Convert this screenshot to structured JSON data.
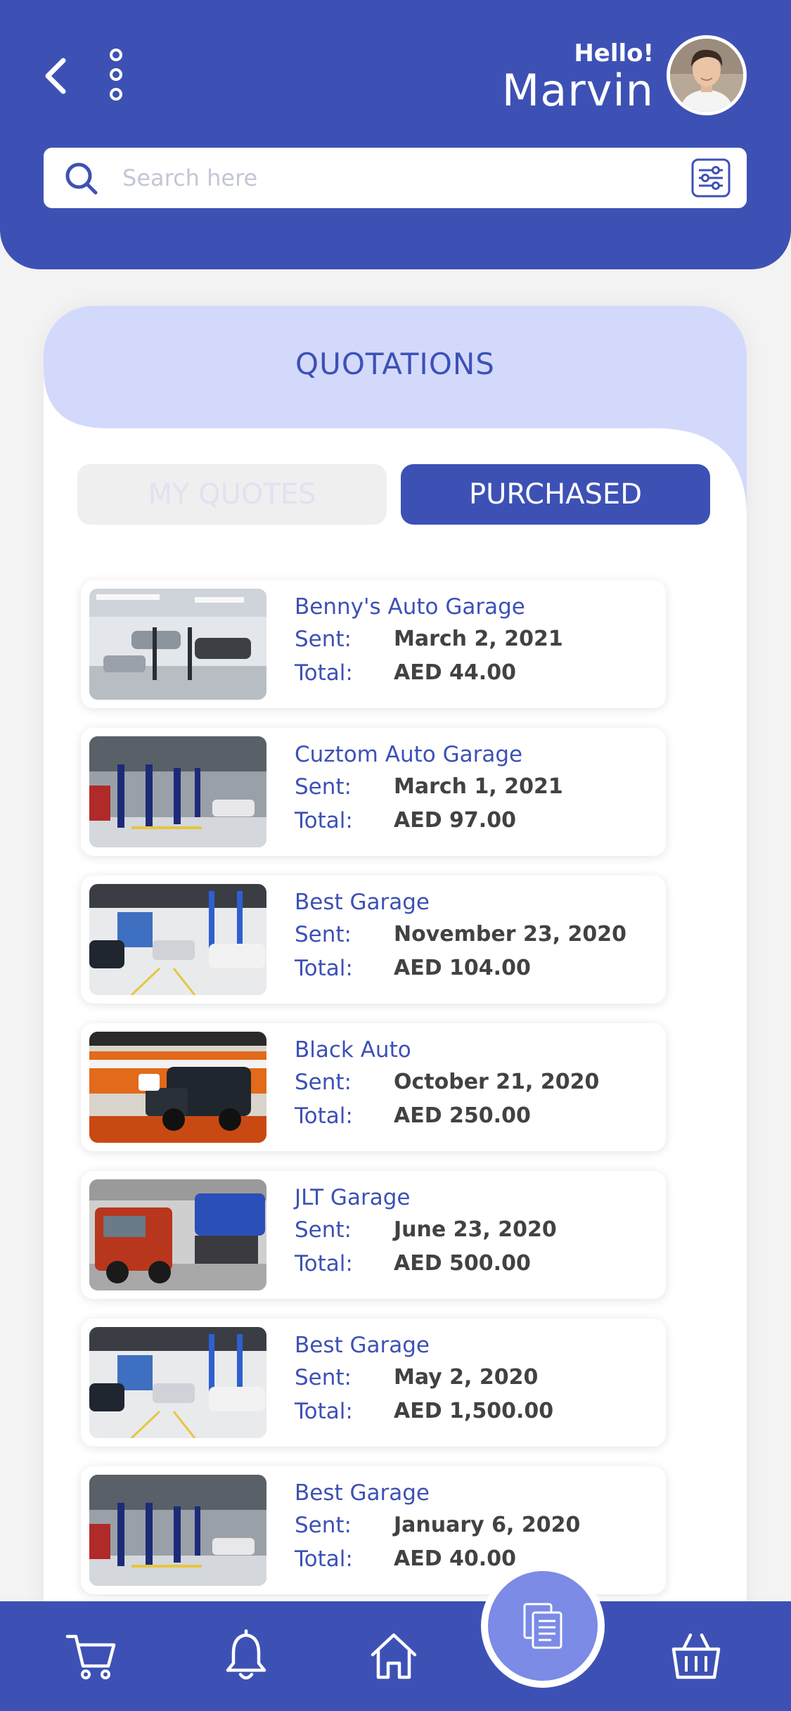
{
  "header": {
    "greeting": "Hello!",
    "user_name": "Marvin",
    "search_placeholder": "Search here"
  },
  "section": {
    "title": "QUOTATIONS",
    "tabs": [
      {
        "label": "MY QUOTES",
        "active": false
      },
      {
        "label": "PURCHASED",
        "active": true
      }
    ]
  },
  "labels": {
    "sent": "Sent:",
    "total": "Total:"
  },
  "quotes": [
    {
      "garage": "Benny's Auto Garage",
      "sent": "March 2, 2021",
      "total": "AED 44.00",
      "image": "garage-interior-lifts"
    },
    {
      "garage": "Cuztom Auto Garage",
      "sent": "March 1, 2021",
      "total": "AED 97.00",
      "image": "garage-blue-lifts"
    },
    {
      "garage": "Best Garage",
      "sent": "November 23, 2020",
      "total": "AED 104.00",
      "image": "garage-white-floor"
    },
    {
      "garage": "Black Auto",
      "sent": "October 21, 2020",
      "total": "AED 250.00",
      "image": "black-truck"
    },
    {
      "garage": "JLT Garage",
      "sent": "June 23, 2020",
      "total": "AED 500.00",
      "image": "trucks-workshop"
    },
    {
      "garage": "Best Garage",
      "sent": "May 2, 2020",
      "total": "AED 1,500.00",
      "image": "garage-white-floor"
    },
    {
      "garage": "Best Garage",
      "sent": "January 6, 2020",
      "total": "AED 40.00",
      "image": "garage-blue-lifts"
    }
  ],
  "nav": {
    "items": [
      "cart-icon",
      "bell-icon",
      "home-icon",
      "quotes-document-icon",
      "basket-icon"
    ],
    "active": "quotes-document-icon"
  },
  "colors": {
    "primary": "#3d51b5",
    "accent_light": "#d3d9fb",
    "fab": "#7b8be6",
    "background": "#f3f3f4"
  }
}
